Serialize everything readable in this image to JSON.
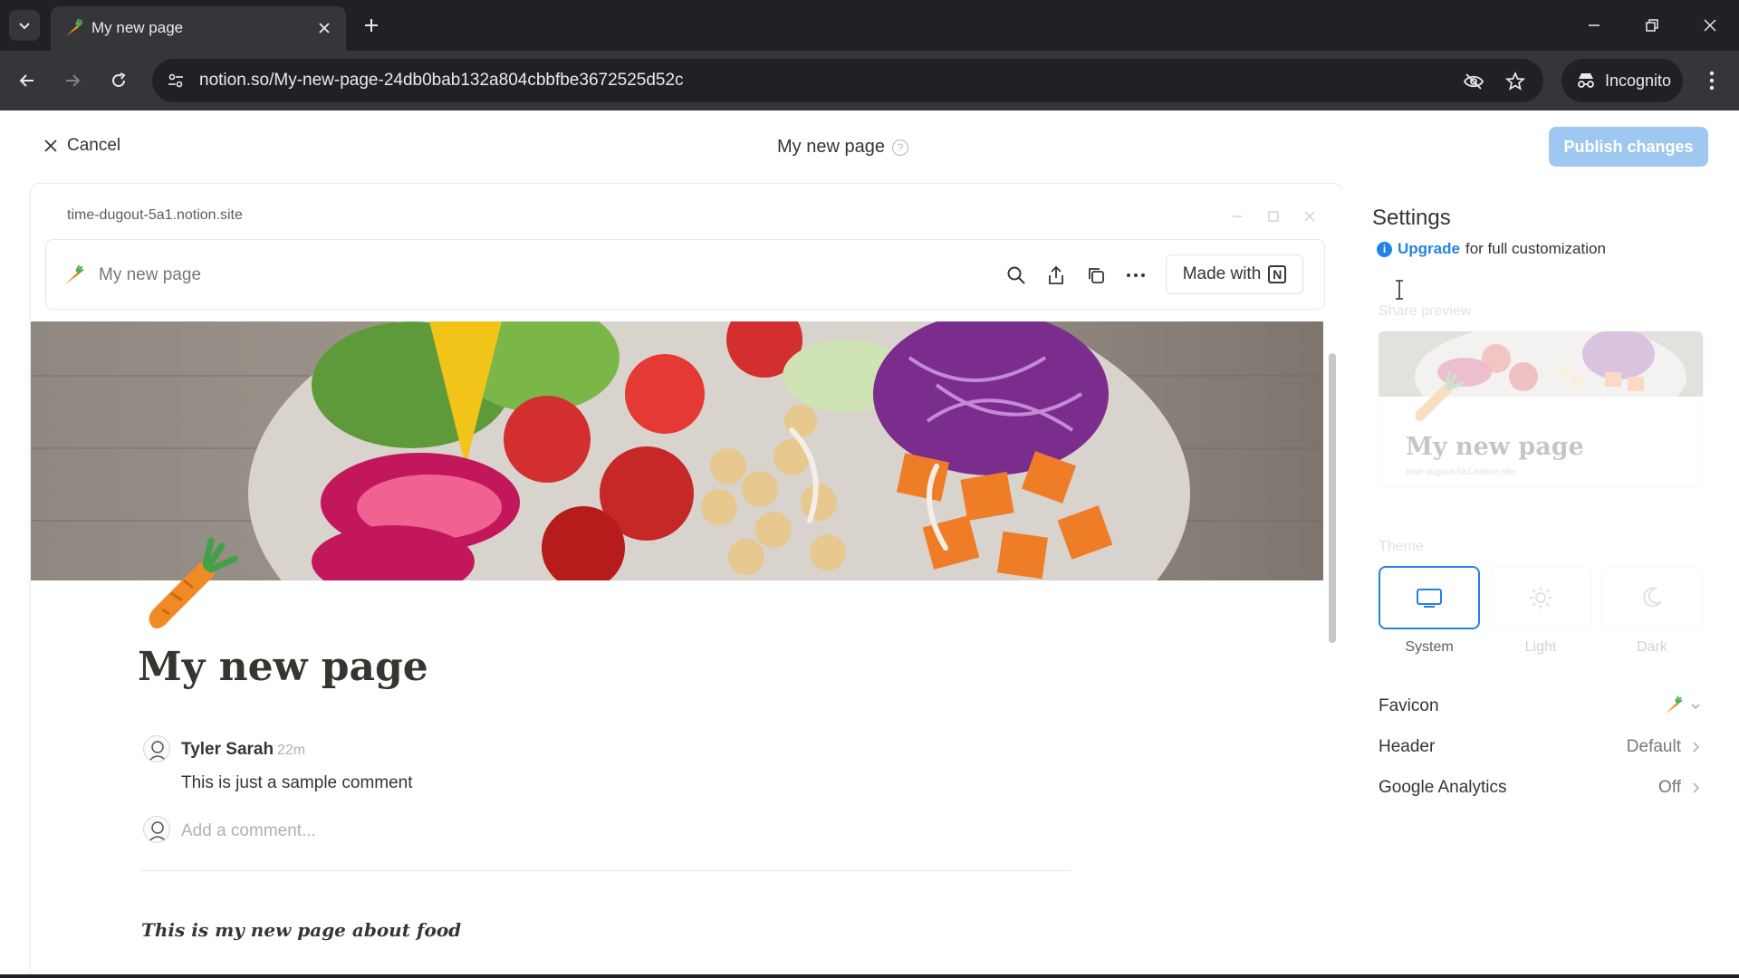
{
  "browser": {
    "tab_title": "My new page",
    "url": "notion.so/My-new-page-24db0bab132a804cbbfbe3672525d52c",
    "incognito_label": "Incognito"
  },
  "topbar": {
    "cancel_label": "Cancel",
    "page_title": "My new page",
    "help_glyph": "?",
    "publish_label": "Publish changes"
  },
  "preview": {
    "domain": "time-dugout-5a1.notion.site",
    "header_title": "My new page",
    "made_with_label": "Made with",
    "notion_logo_letter": "N",
    "page_title": "My new page",
    "comment": {
      "author": "Tyler Sarah",
      "time": "22m",
      "text": "This is just a sample comment"
    },
    "add_comment_placeholder": "Add a comment...",
    "body_text": "This is my new page about food"
  },
  "settings": {
    "title": "Settings",
    "info_glyph": "i",
    "upgrade_link": "Upgrade",
    "upgrade_text": "for full customization",
    "share_preview_label": "Share preview",
    "share_preview_title": "My new page",
    "share_preview_domain": "time-dugout-5a1.notion.site",
    "theme_label": "Theme",
    "themes": [
      {
        "name": "System",
        "selected": true
      },
      {
        "name": "Light",
        "selected": false
      },
      {
        "name": "Dark",
        "selected": false
      }
    ],
    "rows": [
      {
        "label": "Favicon",
        "value": ""
      },
      {
        "label": "Header",
        "value": "Default"
      },
      {
        "label": "Google Analytics",
        "value": "Off"
      }
    ]
  },
  "colors": {
    "accent": "#2383e2",
    "publish_disabled": "#9ec8ef",
    "chrome_dark": "#202124",
    "chrome_mid": "#35363a"
  }
}
